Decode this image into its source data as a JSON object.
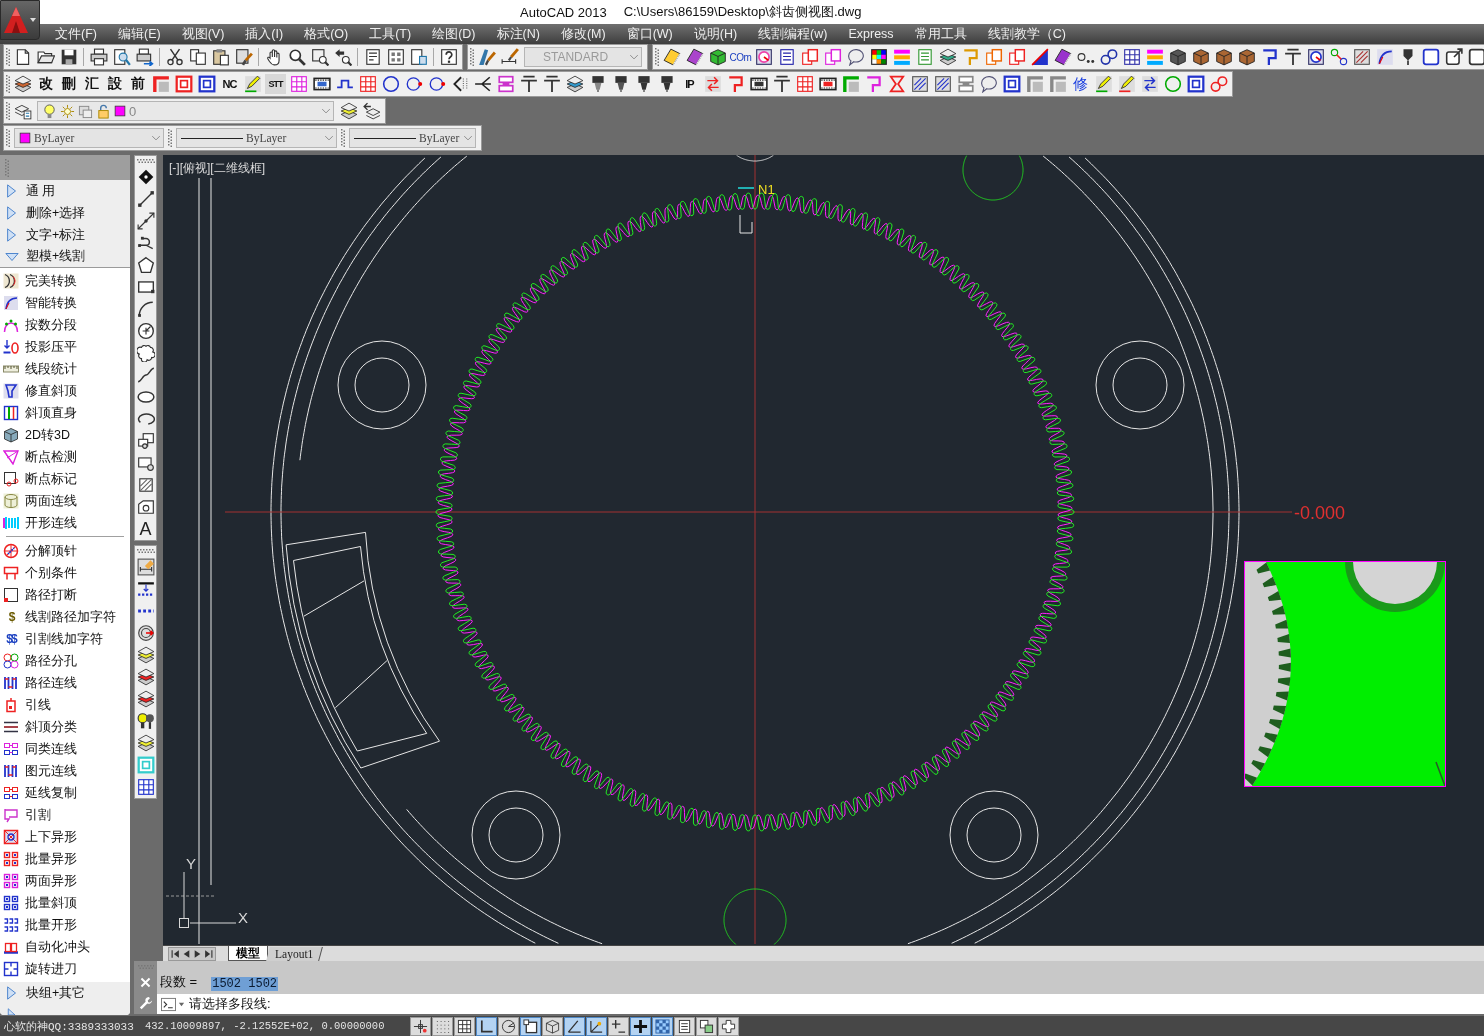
{
  "window": {
    "title": "AutoCAD 2013",
    "file_path": "C:\\Users\\86159\\Desktop\\斜齿侧视图.dwg"
  },
  "menu_bar": [
    "文件(F)",
    "编辑(E)",
    "视图(V)",
    "插入(I)",
    "格式(O)",
    "工具(T)",
    "绘图(D)",
    "标注(N)",
    "修改(M)",
    "窗口(W)",
    "说明(H)",
    "线割编程(w)",
    "Express",
    "常用工具",
    "线割教学（C)"
  ],
  "toolbars": {
    "text_style": {
      "value": "STANDARD",
      "disabled": true
    },
    "glyph_buttons": [
      "COm"
    ],
    "wire_cut_glyph_buttons": [
      "改",
      "刪",
      "汇",
      "設",
      "前",
      "NC",
      "STT",
      "IP",
      "修"
    ],
    "layer": {
      "value": "0"
    },
    "properties": [
      {
        "kind": "color",
        "value": "ByLayer"
      },
      {
        "kind": "linetype",
        "value": "ByLayer"
      },
      {
        "kind": "lineweight",
        "value": "ByLayer"
      }
    ]
  },
  "side_panel": {
    "categories": [
      {
        "label": "通 用",
        "expanded": false
      },
      {
        "label": "删除+选择",
        "expanded": false
      },
      {
        "label": "文字+标注",
        "expanded": false
      },
      {
        "label": "塑模+线割",
        "expanded": true,
        "groups": [
          [
            {
              "label": "完美转换"
            },
            {
              "label": "智能转换"
            },
            {
              "label": "按数分段"
            },
            {
              "label": "投影压平"
            },
            {
              "label": "线段统计"
            },
            {
              "label": "修直斜顶"
            },
            {
              "label": "斜顶直身"
            },
            {
              "label": "2D转3D"
            },
            {
              "label": "断点检测"
            },
            {
              "label": "断点标记"
            },
            {
              "label": "两面连线"
            },
            {
              "label": "开形连线"
            }
          ],
          [
            {
              "label": "分解顶针"
            },
            {
              "label": "个别条件"
            },
            {
              "label": "路径打断"
            },
            {
              "label": "线割路径加字符",
              "icon_glyph": "$"
            },
            {
              "label": "引割线加字符",
              "icon_glyph": "$$"
            },
            {
              "label": "路径分孔"
            },
            {
              "label": "路径连线"
            },
            {
              "label": "引线"
            },
            {
              "label": "斜顶分类"
            },
            {
              "label": "同类连线"
            },
            {
              "label": "图元连线"
            },
            {
              "label": "延线复制"
            },
            {
              "label": "引割"
            },
            {
              "label": "上下异形"
            },
            {
              "label": "批量异形"
            },
            {
              "label": "两面异形"
            },
            {
              "label": "批量斜顶"
            },
            {
              "label": "批量开形"
            },
            {
              "label": "自动化冲头"
            },
            {
              "label": "旋转进刀"
            }
          ]
        ]
      },
      {
        "label": "块组+其它",
        "expanded": false
      }
    ]
  },
  "draw_toolbar": {
    "text_tool": "A"
  },
  "viewport": {
    "label": "[-][俯视][二维线框]",
    "start_point_label": "N1",
    "dimension_text": "-0.000",
    "ucs_x": "X",
    "ucs_y": "Y"
  },
  "layout_tabs": [
    {
      "label": "模型",
      "selected": true
    },
    {
      "label": "Layout1",
      "selected": false
    }
  ],
  "command_line": {
    "history_label": "段数 =",
    "history_value": "1502 1502",
    "value_highlighted": true,
    "prompt": "请选择多段线:"
  },
  "status_bar": {
    "plugin_text": "心软的神QQ:3389333033",
    "coordinates": "432.10009897, -2.12552E+02, 0.00000000",
    "toggles": [
      {
        "on": false
      },
      {
        "on": false
      },
      {
        "on": false
      },
      {
        "on": true
      },
      {
        "on": false
      },
      {
        "on": true
      },
      {
        "on": false
      },
      {
        "on": true
      },
      {
        "on": true
      },
      {
        "on": false
      },
      {
        "on": true
      },
      {
        "on": true
      },
      {
        "on": false
      },
      {
        "on": false
      },
      {
        "on": false
      }
    ]
  }
}
